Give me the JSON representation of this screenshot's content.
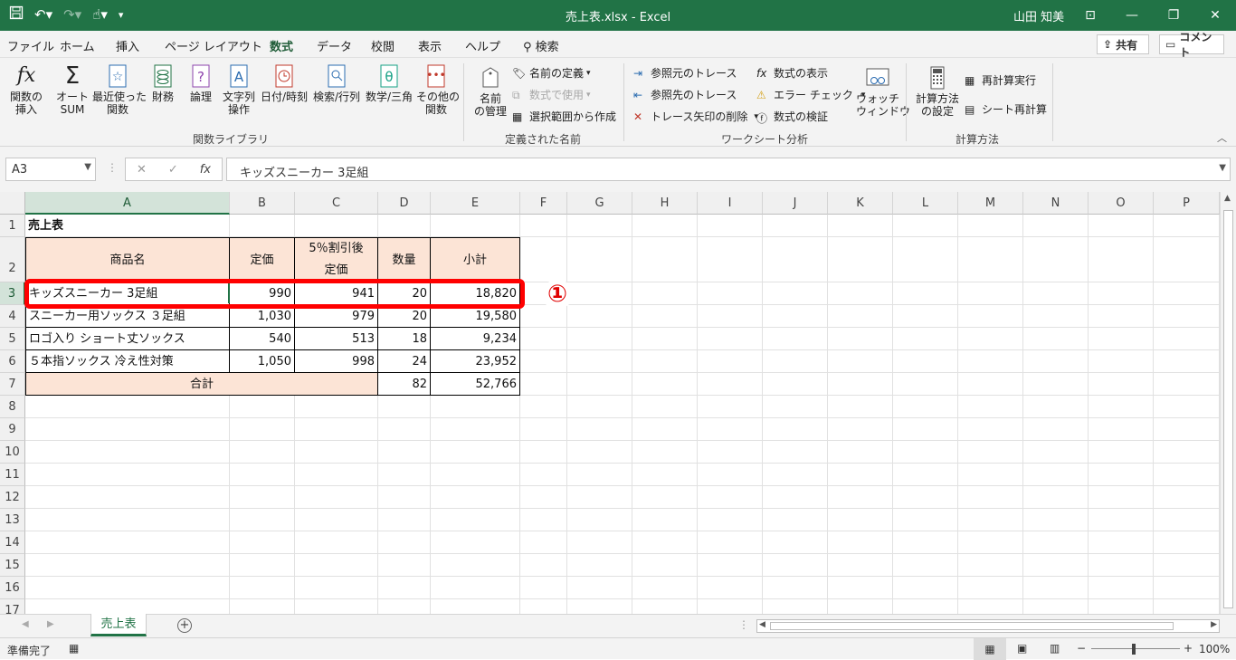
{
  "window": {
    "title": "売上表.xlsx  -  Excel",
    "user": "山田 知美",
    "colors": {
      "accent": "#217346",
      "header_fill": "#fce4d6",
      "highlight": "#ff0000"
    }
  },
  "tabs": [
    "ファイル",
    "ホーム",
    "挿入",
    "ページ レイアウト",
    "数式",
    "データ",
    "校閲",
    "表示",
    "ヘルプ",
    "検索"
  ],
  "active_tab": "数式",
  "share": {
    "share_label": "共有",
    "comment_label": "コメント"
  },
  "ribbon": {
    "library": {
      "insert_function": "関数の\n挿入",
      "autosum": "オート\nSUM",
      "recent": "最近使った\n関数",
      "financial": "財務",
      "logical": "論理",
      "text": "文字列\n操作",
      "datetime": "日付/時刻",
      "lookup": "検索/行列",
      "math": "数学/三角",
      "more": "その他の\n関数",
      "group_label": "関数ライブラリ"
    },
    "names": {
      "name_manager": "名前\nの管理",
      "define_name": "名前の定義",
      "use_in_formula": "数式で使用",
      "create_from_selection": "選択範囲から作成",
      "group_label": "定義された名前"
    },
    "audit": {
      "trace_precedents": "参照元のトレース",
      "trace_dependents": "参照先のトレース",
      "remove_arrows": "トレース矢印の削除",
      "show_formulas": "数式の表示",
      "error_checking": "エラー チェック",
      "evaluate_formula": "数式の検証",
      "watch_window": "ウォッチ\nウィンドウ",
      "group_label": "ワークシート分析"
    },
    "calc": {
      "calc_options": "計算方法\nの設定",
      "calc_now": "再計算実行",
      "calc_sheet": "シート再計算",
      "group_label": "計算方法"
    }
  },
  "formula_bar": {
    "name_box": "A3",
    "fx": "fx",
    "content": "キッズスニーカー 3足組"
  },
  "columns": [
    "A",
    "B",
    "C",
    "D",
    "E",
    "F",
    "G",
    "H",
    "I",
    "J",
    "K",
    "L",
    "M",
    "N",
    "O",
    "P"
  ],
  "rows": [
    "1",
    "2",
    "3",
    "4",
    "5",
    "6",
    "7",
    "8",
    "9",
    "10",
    "11",
    "12",
    "13",
    "14",
    "15",
    "16",
    "17"
  ],
  "sheet": {
    "title": "売上表",
    "headers": {
      "name": "商品名",
      "price": "定価",
      "discount_line1": "5％割引後",
      "discount_line2": "定価",
      "qty": "数量",
      "subtotal": "小計"
    },
    "items": [
      {
        "name": "キッズスニーカー 3足組",
        "price": "990",
        "discount": "941",
        "qty": "20",
        "subtotal": "18,820"
      },
      {
        "name": "スニーカー用ソックス ３足組",
        "price": "1,030",
        "discount": "979",
        "qty": "20",
        "subtotal": "19,580"
      },
      {
        "name": "ロゴ入り ショート丈ソックス",
        "price": "540",
        "discount": "513",
        "qty": "18",
        "subtotal": "9,234"
      },
      {
        "name": "５本指ソックス 冷え性対策",
        "price": "1,050",
        "discount": "998",
        "qty": "24",
        "subtotal": "23,952"
      }
    ],
    "total": {
      "label": "合計",
      "qty": "82",
      "subtotal": "52,766"
    }
  },
  "annotation": {
    "marker": "①"
  },
  "sheet_tab": "売上表",
  "status": {
    "ready": "準備完了",
    "zoom": "100%"
  }
}
